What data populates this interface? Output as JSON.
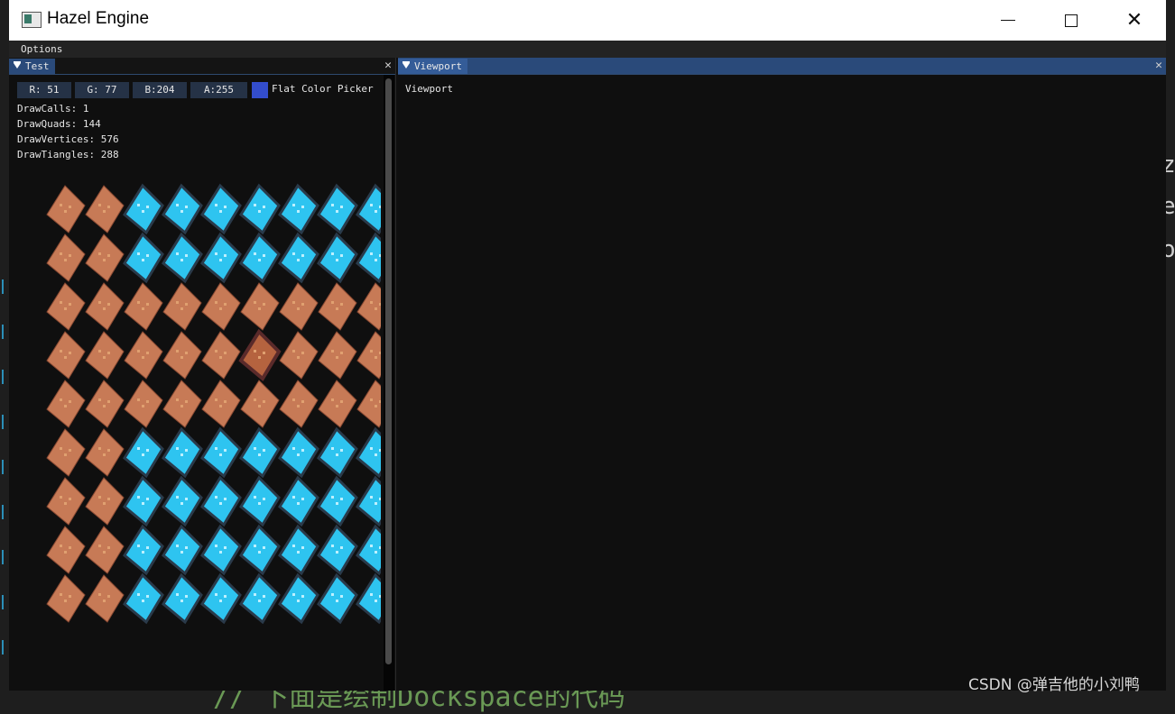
{
  "window": {
    "title": "Hazel Engine",
    "minimize": "minimize",
    "maximize": "maximize",
    "close": "close"
  },
  "menubar": {
    "items": [
      "Options"
    ]
  },
  "test_panel": {
    "tab_label": "Test",
    "fields": [
      {
        "label": "R: 51"
      },
      {
        "label": "G: 77"
      },
      {
        "label": "B:204"
      },
      {
        "label": "A:255"
      }
    ],
    "swatch_color": "#334dcc",
    "picker_label": "Flat Color Picker",
    "stats": [
      "DrawCalls: 1",
      "DrawQuads: 144",
      "DrawVertices: 576",
      "DrawTiangles: 288"
    ],
    "tiles": {
      "columns": 9,
      "rows": 9,
      "pattern": [
        "DDWWWWWWW",
        "DDWWWWWWW",
        "DDDDDDDDD",
        "DDDDDCDDD",
        "DDDDDDDDD",
        "DDWWWWWWW",
        "DDWWWWWWW",
        "DDWWWWWWW",
        "DDWWWWWWW"
      ],
      "dirt_color": "#c77a56",
      "water_color": "#2ec4f0",
      "center_color": "#b5633f"
    }
  },
  "viewport_panel": {
    "tab_label": "Viewport",
    "content_label": "Viewport"
  },
  "background": {
    "watermark": "CSDN @弹吉他的小刘鸭",
    "bottom_code": "// 下面是绘制Dockspace的代码"
  },
  "colors": {
    "tab_active": "#2a4a7a",
    "field_bg": "#253246",
    "panel_bg": "#0f0f0f"
  }
}
